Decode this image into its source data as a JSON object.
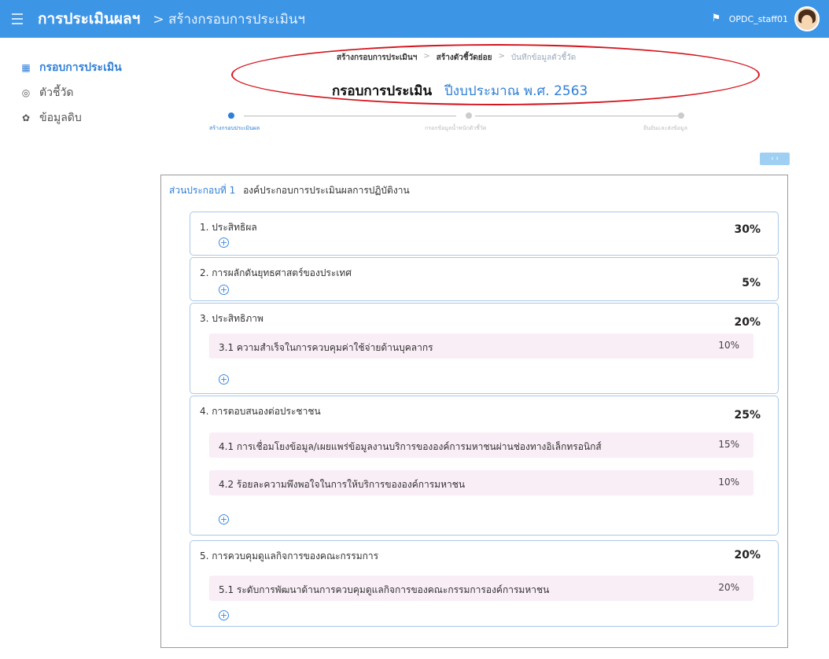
{
  "header": {
    "app_title": "การประเมินผลฯ",
    "breadcrumb": "> สร้างกรอบการประเมินฯ",
    "user": "OPDC_staff01"
  },
  "sidebar": {
    "items": [
      {
        "label": "กรอบการประเมิน",
        "icon": "grid-icon"
      },
      {
        "label": "ตัวชี้วัด",
        "icon": "target-icon"
      },
      {
        "label": "ข้อมูลดิบ",
        "icon": "puzzle-icon"
      }
    ]
  },
  "wizard": {
    "crumbs": [
      "สร้างกรอบการประเมินฯ",
      "สร้างตัวชี้วัดย่อย",
      "บันทึกข้อมูลตัวชี้วัด"
    ],
    "title": "กรอบการประเมิน",
    "year": "ปีงบประมาณ พ.ศ. 2563",
    "steps": [
      "สร้างกรอบประเมินผล",
      "กรอกข้อมูลน้ำหนักตัวชี้วัด",
      "ยืนยันและส่งข้อมูล"
    ]
  },
  "panel": {
    "part_label": "ส่วนประกอบที่ 1",
    "part_name": "องค์ประกอบการประเมินผลการปฏิบัติงาน",
    "sections": [
      {
        "name": "1. ประสิทธิผล",
        "weight": "30%",
        "subs": []
      },
      {
        "name": "2. การผลักดันยุทธศาสตร์ของประเทศ",
        "weight": "5%",
        "subs": []
      },
      {
        "name": "3. ประสิทธิภาพ",
        "weight": "20%",
        "subs": [
          {
            "name": "3.1 ความสำเร็จในการควบคุมค่าใช้จ่ายด้านบุคลากร",
            "weight": "10%"
          }
        ]
      },
      {
        "name": "4. การตอบสนองต่อประชาชน",
        "weight": "25%",
        "subs": [
          {
            "name": "4.1 การเชื่อมโยงข้อมูล/เผยแพร่ข้อมูลงานบริการขององค์การมหาชนผ่านช่องทางอิเล็กทรอนิกส์",
            "weight": "15%"
          },
          {
            "name": "4.2 ร้อยละความพึงพอใจในการให้บริการขององค์การมหาชน",
            "weight": "10%"
          }
        ]
      },
      {
        "name": "5. การควบคุมดูแลกิจการของคณะกรรมการ",
        "weight": "20%",
        "subs": [
          {
            "name": "5.1 ระดับการพัฒนาด้านการควบคุมดูแลกิจการของคณะกรรมการองค์การมหาชน",
            "weight": "20%"
          }
        ]
      }
    ]
  }
}
